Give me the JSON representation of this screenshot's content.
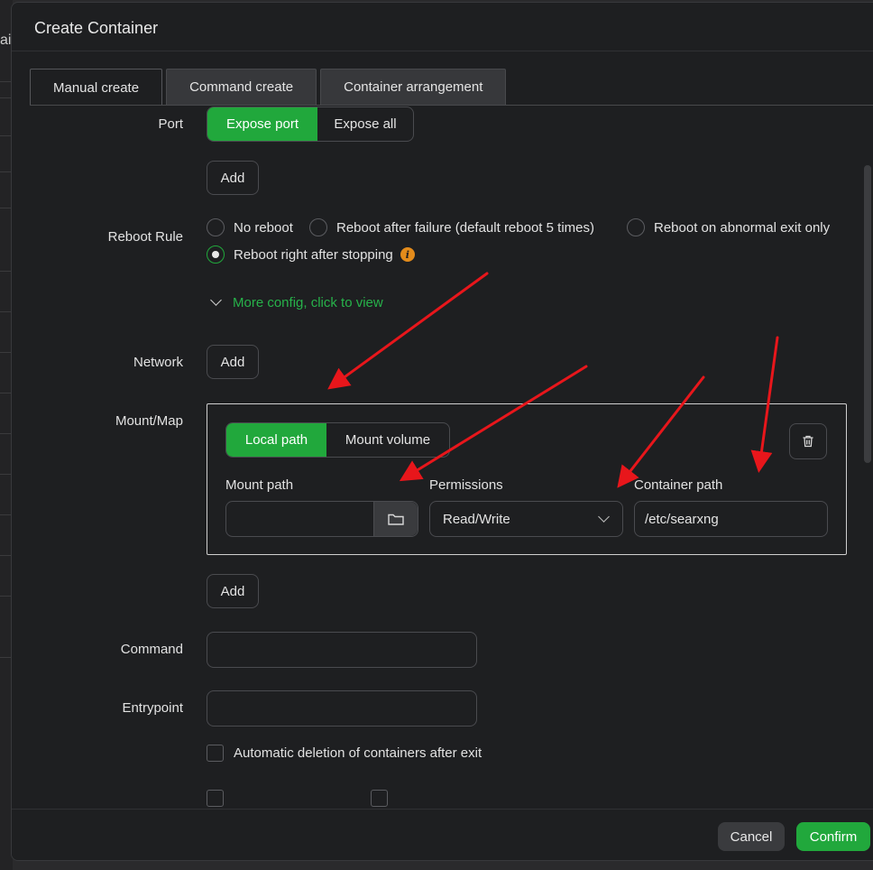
{
  "background": {
    "partial_text": "ai"
  },
  "dialog": {
    "title": "Create Container",
    "tabs": [
      {
        "label": "Manual create",
        "active": true
      },
      {
        "label": "Command create",
        "active": false
      },
      {
        "label": "Container arrangement",
        "active": false
      }
    ]
  },
  "port": {
    "label": "Port",
    "options": [
      "Expose port",
      "Expose all"
    ],
    "selected": "Expose port",
    "add_label": "Add"
  },
  "reboot": {
    "label": "Reboot Rule",
    "options": [
      {
        "label": "No reboot",
        "selected": false
      },
      {
        "label": "Reboot after failure (default reboot 5 times)",
        "selected": false
      },
      {
        "label": "Reboot on abnormal exit only",
        "selected": false
      },
      {
        "label": "Reboot right after stopping",
        "selected": true
      }
    ]
  },
  "more_config": "More config, click to view",
  "network": {
    "label": "Network",
    "add_label": "Add"
  },
  "mount": {
    "label": "Mount/Map",
    "types": [
      "Local path",
      "Mount volume"
    ],
    "selected_type": "Local path",
    "mount_path_label": "Mount path",
    "mount_path_value": "",
    "permissions_label": "Permissions",
    "permissions_value": "Read/Write",
    "container_path_label": "Container path",
    "container_path_value": "/etc/searxng",
    "add_label": "Add"
  },
  "command": {
    "label": "Command",
    "value": ""
  },
  "entrypoint": {
    "label": "Entrypoint",
    "value": ""
  },
  "auto_delete": {
    "label": "Automatic deletion of containers after exit",
    "checked": false
  },
  "footer": {
    "cancel_label": "Cancel",
    "confirm_label": "Confirm"
  },
  "colors": {
    "accent": "#21a83c",
    "warning_icon": "#e38b1b",
    "annotation_arrows": "#e8161b"
  }
}
